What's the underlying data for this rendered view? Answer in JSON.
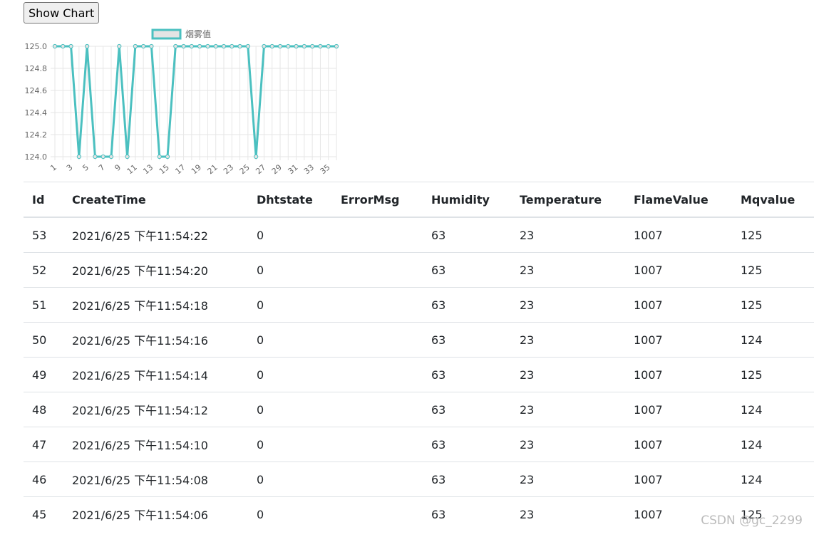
{
  "button": {
    "label": "Show Chart"
  },
  "chart_data": {
    "type": "line",
    "title": "",
    "series": [
      {
        "name": "烟雾值",
        "values": [
          125,
          125,
          125,
          124,
          125,
          124,
          124,
          124,
          125,
          124,
          125,
          125,
          125,
          124,
          124,
          125,
          125,
          125,
          125,
          125,
          125,
          125,
          125,
          125,
          125,
          124,
          125,
          125,
          125,
          125,
          125,
          125,
          125,
          125,
          125,
          125
        ]
      }
    ],
    "x": [
      1,
      2,
      3,
      4,
      5,
      6,
      7,
      8,
      9,
      10,
      11,
      12,
      13,
      14,
      15,
      16,
      17,
      18,
      19,
      20,
      21,
      22,
      23,
      24,
      25,
      26,
      27,
      28,
      29,
      30,
      31,
      32,
      33,
      34,
      35,
      36
    ],
    "x_tick_labels": [
      "1",
      "3",
      "5",
      "7",
      "9",
      "11",
      "13",
      "15",
      "17",
      "19",
      "21",
      "23",
      "25",
      "27",
      "29",
      "31",
      "33",
      "35"
    ],
    "y_tick_labels": [
      "125.0",
      "124.8",
      "124.6",
      "124.4",
      "124.2",
      "124.0"
    ],
    "ylim": [
      124.0,
      125.0
    ],
    "color": "#4bc0c0",
    "fill_color": "#e4e4e4",
    "grid": true,
    "legend": "top"
  },
  "table": {
    "headers": [
      "Id",
      "CreateTime",
      "Dhtstate",
      "ErrorMsg",
      "Humidity",
      "Temperature",
      "FlameValue",
      "Mqvalue"
    ],
    "rows": [
      [
        "53",
        "2021/6/25 下午11:54:22",
        "0",
        "",
        "63",
        "23",
        "1007",
        "125"
      ],
      [
        "52",
        "2021/6/25 下午11:54:20",
        "0",
        "",
        "63",
        "23",
        "1007",
        "125"
      ],
      [
        "51",
        "2021/6/25 下午11:54:18",
        "0",
        "",
        "63",
        "23",
        "1007",
        "125"
      ],
      [
        "50",
        "2021/6/25 下午11:54:16",
        "0",
        "",
        "63",
        "23",
        "1007",
        "124"
      ],
      [
        "49",
        "2021/6/25 下午11:54:14",
        "0",
        "",
        "63",
        "23",
        "1007",
        "125"
      ],
      [
        "48",
        "2021/6/25 下午11:54:12",
        "0",
        "",
        "63",
        "23",
        "1007",
        "124"
      ],
      [
        "47",
        "2021/6/25 下午11:54:10",
        "0",
        "",
        "63",
        "23",
        "1007",
        "124"
      ],
      [
        "46",
        "2021/6/25 下午11:54:08",
        "0",
        "",
        "63",
        "23",
        "1007",
        "124"
      ],
      [
        "45",
        "2021/6/25 下午11:54:06",
        "0",
        "",
        "63",
        "23",
        "1007",
        "125"
      ]
    ]
  },
  "watermark": "CSDN @gc_2299"
}
